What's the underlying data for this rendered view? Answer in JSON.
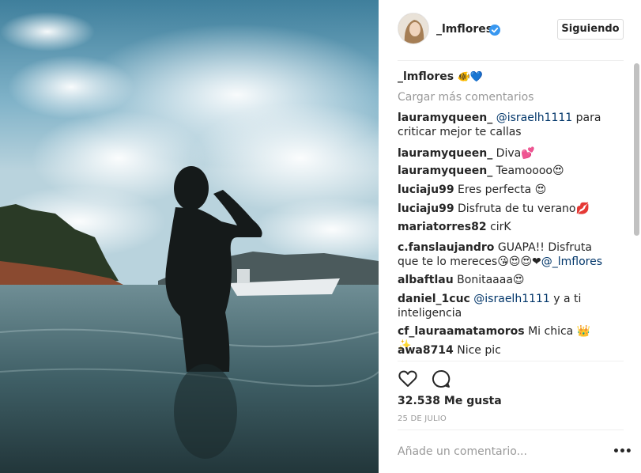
{
  "post": {
    "username": "_lmflores",
    "follow_label": "Siguiendo",
    "caption": {
      "user": "_lmflores",
      "text": "🐠💙"
    },
    "load_more": "Cargar más comentarios",
    "comments": [
      {
        "user": "lauramyqueen_",
        "mention": "@israelh1111",
        "text": " para criticar mejor te callas"
      },
      {
        "user": "lauramyqueen_",
        "text": " Diva💕"
      },
      {
        "user": "lauramyqueen_",
        "text": " Teamoooo😍"
      },
      {
        "user": "luciaju99",
        "text": " Eres perfecta 😍"
      },
      {
        "user": "luciaju99",
        "text": " Disfruta de tu verano💋"
      },
      {
        "user": "mariatorres82",
        "text": " cirK"
      },
      {
        "user": "c.fanslaujandro",
        "text": " GUAPA!! Disfruta que te lo mereces😘😍😍❤",
        "mention": "@_lmflores"
      },
      {
        "user": "albaftlau",
        "text": " Bonitaaaa😍"
      },
      {
        "user": "daniel_1cuc",
        "mention": "@israelh1111",
        "text": " y a ti inteligencia"
      },
      {
        "user": "cf_lauraamatamoros",
        "text": " Mi chica 👑✨"
      },
      {
        "user": "awa8714",
        "text": " Nice pic"
      }
    ],
    "likes": "32.538 Me gusta",
    "date": "25 DE JULIO",
    "comment_placeholder": "Añade un comentario...",
    "more_label": "•••"
  },
  "icons": {
    "verified": "verified-badge-icon",
    "like": "heart-icon",
    "comment": "comment-bubble-icon",
    "more": "more-options-icon"
  },
  "colors": {
    "verified": "#3897f0",
    "mention": "#003569",
    "muted": "#999999",
    "border": "#dbdbdb"
  }
}
